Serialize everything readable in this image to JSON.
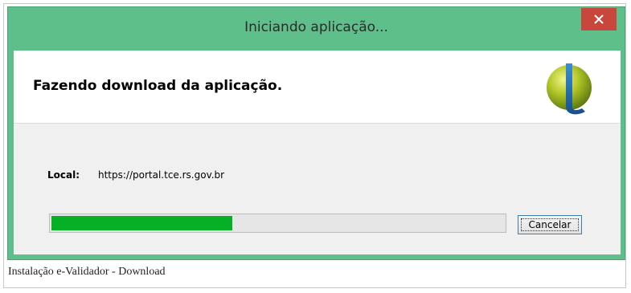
{
  "window": {
    "title": "Iniciando aplicação..."
  },
  "header": {
    "text": "Fazendo download da aplicação."
  },
  "location": {
    "label": "Local:",
    "value": "https://portal.tce.rs.gov.br"
  },
  "progress": {
    "percent": 40,
    "color": "#06b025"
  },
  "buttons": {
    "cancel_label": "Cancelar"
  },
  "caption": {
    "text": "Instalação e-Validador - Download"
  },
  "colors": {
    "titlebar": "#5fbf8a",
    "close_button": "#c9463d"
  },
  "icons": {
    "close": "close-icon",
    "logo": "app-logo-icon"
  }
}
